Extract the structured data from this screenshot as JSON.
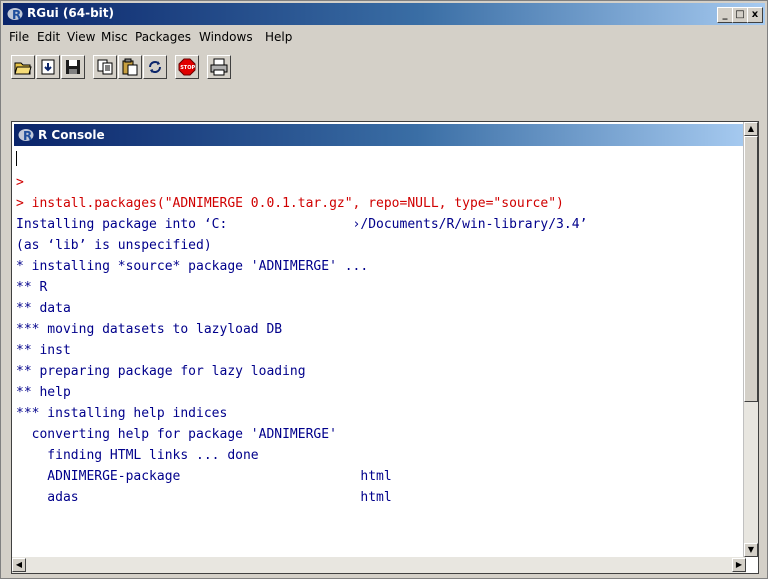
{
  "window": {
    "title": "RGui (64-bit)",
    "minimize": "_",
    "maximize": "□",
    "close": "x"
  },
  "menu": [
    "File",
    "Edit",
    "View",
    "Misc",
    "Packages",
    "Windows",
    "Help"
  ],
  "toolbar": {
    "buttons": [
      "open-script-icon",
      "load-workspace-icon",
      "save-workspace-icon",
      "copy-icon",
      "paste-icon",
      "copy-paste-icon",
      "stop-icon",
      "print-icon"
    ],
    "stop_label": "STOP"
  },
  "console": {
    "title": "R Console",
    "lines": [
      {
        "text": "",
        "color": "red",
        "cursor": true
      },
      {
        "text": ">",
        "color": "red"
      },
      {
        "text": "> install.packages(\"ADNIMERGE 0.0.1.tar.gz\", repo=NULL, type=\"source\")",
        "color": "red"
      },
      {
        "text": "Installing package into ‘C:                ›/Documents/R/win-library/3.4’",
        "color": "blue"
      },
      {
        "text": "(as ‘lib’ is unspecified)",
        "color": "blue"
      },
      {
        "text": "* installing *source* package 'ADNIMERGE' ...",
        "color": "blue"
      },
      {
        "text": "** R",
        "color": "blue"
      },
      {
        "text": "** data",
        "color": "blue"
      },
      {
        "text": "*** moving datasets to lazyload DB",
        "color": "blue"
      },
      {
        "text": "** inst",
        "color": "blue"
      },
      {
        "text": "** preparing package for lazy loading",
        "color": "blue"
      },
      {
        "text": "** help",
        "color": "blue"
      },
      {
        "text": "*** installing help indices",
        "color": "blue"
      },
      {
        "text": "  converting help for package 'ADNIMERGE'",
        "color": "blue"
      },
      {
        "text": "    finding HTML links ... done",
        "color": "blue"
      },
      {
        "text": "    ADNIMERGE-package                       html",
        "color": "blue"
      },
      {
        "text": "    adas                                    html",
        "color": "blue"
      }
    ]
  },
  "colors": {
    "red": "#d00000",
    "blue": "#00008b",
    "title_bar": "#0a246a"
  }
}
